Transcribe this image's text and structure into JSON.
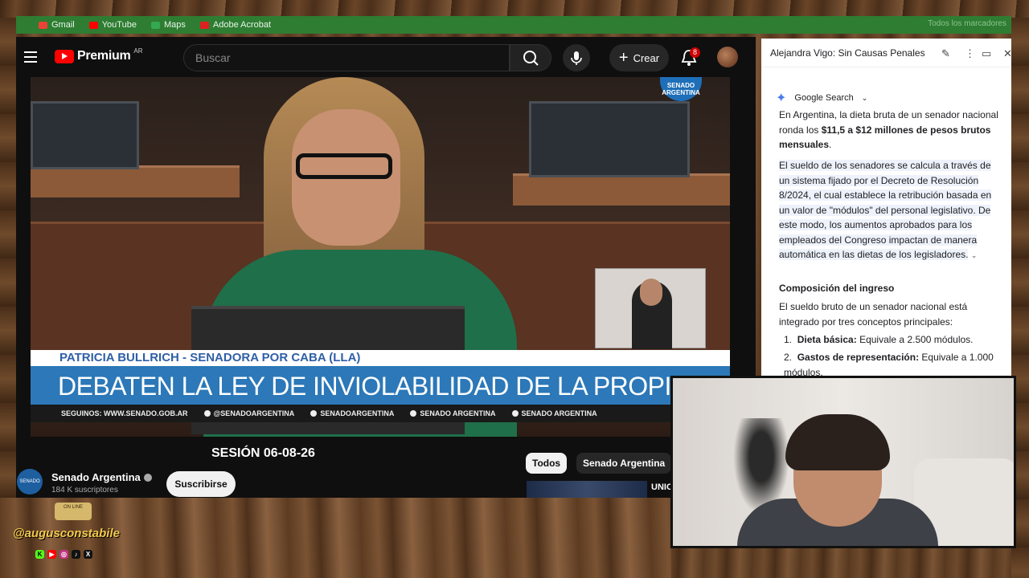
{
  "bookmarks": [
    {
      "label": "Gmail",
      "color": "#ea4335"
    },
    {
      "label": "YouTube",
      "color": "#ff0000"
    },
    {
      "label": "Maps",
      "color": "#34a853"
    },
    {
      "label": "Adobe Acrobat",
      "color": "#e02020"
    }
  ],
  "bookmarks_right": "Todos los marcadores",
  "youtube": {
    "brand": "Premium",
    "country": "AR",
    "search_placeholder": "Buscar",
    "create_label": "Crear",
    "notification_count": "8"
  },
  "video": {
    "logo_text": "SENADO ARGENTINA",
    "lower_name": "PATRICIA BULLRICH - SENADORA POR CABA (LLA)",
    "lower_headline": "DEBATEN LA LEY DE INVIOLABILIDAD DE LA PROPIEDAD PRIVADA",
    "follow_label": "SEGUINOS:",
    "follow_links": [
      "WWW.SENADO.GOB.AR",
      "@SENADOARGENTINA",
      "SENADOARGENTINA",
      "SENADO ARGENTINA",
      "SENADO ARGENTINA"
    ],
    "title": "SESIÓN 06-08-26"
  },
  "channel": {
    "name": "Senado Argentina",
    "subscribers": "184 K suscriptores",
    "subscribe_label": "Suscribirse",
    "avatar_text": "SENADO"
  },
  "chips": {
    "all": "Todos",
    "channel": "Senado Argentina"
  },
  "related": {
    "title": "UNIC"
  },
  "panel": {
    "title": "Alejandra Vigo: Sin Causas Penales",
    "source": "Google Search",
    "p1_a": "En Argentina, la dieta bruta de un senador nacional ronda los ",
    "p1_b": "$11,5 a $12 millones de pesos brutos mensuales",
    "p1_c": ".",
    "p2": "El sueldo de los senadores se calcula a través de un sistema fijado por el Decreto de Resolución 8/2024, el cual establece la retribución basada en un valor de \"módulos\" del personal legislativo. De este modo, los aumentos aprobados para los empleados del Congreso impactan de manera automática en las dietas de los legisladores.",
    "heading": "Composición del ingreso",
    "p3": "El sueldo bruto de un senador nacional está integrado por tres conceptos principales:",
    "list": [
      {
        "num": "1.",
        "label": "Dieta básica:",
        "text": " Equivale a 2.500 módulos."
      },
      {
        "num": "2.",
        "label": "Gastos de representación:",
        "text": " Equivale a 1.000 módulos."
      }
    ]
  },
  "overlay": {
    "badge": "ON LINE",
    "handle": "@augusconstabile"
  }
}
